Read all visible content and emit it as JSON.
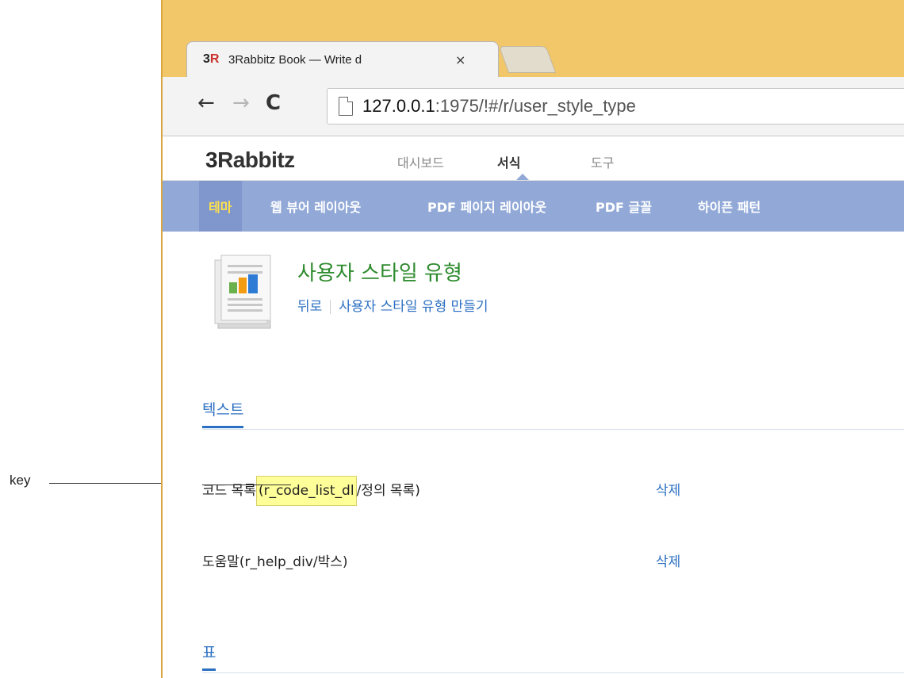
{
  "annotation": {
    "label": "key"
  },
  "browser": {
    "tab": {
      "logo_main": "3",
      "logo_accent": "R",
      "title": "3Rabbitz Book — Write d",
      "close": "×"
    },
    "nav": {
      "back": "←",
      "forward": "→",
      "reload": "C"
    },
    "url": {
      "host": "127.0.0.1",
      "rest": ":1975/!#/r/user_style_type"
    }
  },
  "app": {
    "brand_accent": "3",
    "brand_rest": "Rabbitz",
    "menu": [
      {
        "label": "대시보드",
        "active": false
      },
      {
        "label": "서식",
        "active": true
      },
      {
        "label": "도구",
        "active": false
      }
    ],
    "subnav": [
      {
        "label": "테마",
        "active": true
      },
      {
        "label": "웹 뷰어 레이아웃",
        "active": false
      },
      {
        "label": "PDF 페이지 레이아웃",
        "active": false
      },
      {
        "label": "PDF 글꼴",
        "active": false
      },
      {
        "label": "하이픈 패턴",
        "active": false
      }
    ]
  },
  "content": {
    "title": "사용자 스타일 유형",
    "back_link": "뒤로",
    "create_link": "사용자 스타일 유형 만들기",
    "sections": [
      {
        "name": "텍스트",
        "rows": [
          {
            "label_pre": "코드 목록",
            "label_highlight": "(r_code_list_dl",
            "label_post": "/정의 목록)",
            "action": "삭제"
          },
          {
            "label_pre": "도움말(r_help_div/박스)",
            "label_highlight": "",
            "label_post": "",
            "action": "삭제"
          }
        ]
      },
      {
        "name": "표",
        "rows": []
      }
    ]
  },
  "colors": {
    "window_frame": "#f2c76a",
    "subnav_bg": "#92a9d8",
    "subnav_active_text": "#ffe14d",
    "title_green": "#2e8b2e",
    "link_blue": "#2b6fc2",
    "highlight": "#ffff9a"
  }
}
